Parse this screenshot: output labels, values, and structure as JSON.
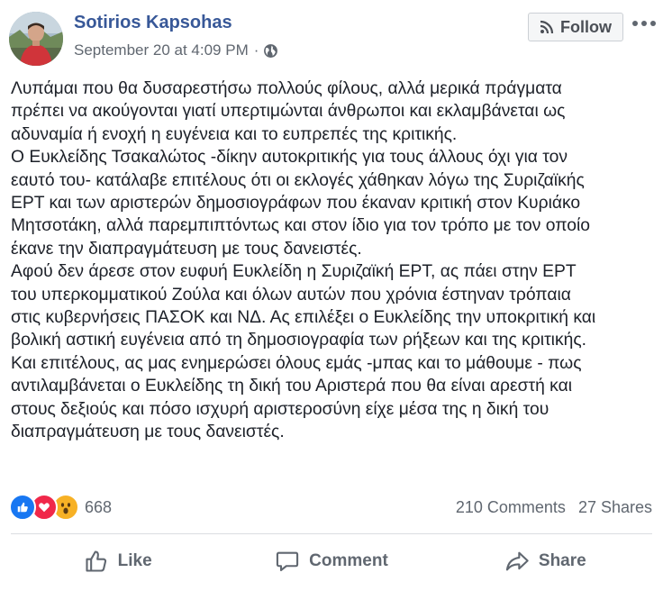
{
  "header": {
    "author": "Sotirios Kapsohas",
    "timestamp": "September 20 at 4:09 PM",
    "separator": "·",
    "privacy_icon": "globe-icon",
    "follow_label": "Follow",
    "follow_icon": "rss-icon",
    "more_icon": "more-options-icon"
  },
  "post": {
    "lines": [
      "Λυπάμαι που θα δυσαρεστήσω πολλούς φίλους, αλλά μερικά πράγματα",
      "πρέπει να ακούγονται γιατί υπερτιμώνται άνθρωποι και εκλαμβάνεται ως",
      "αδυναμία ή ενοχή η ευγένεια και το ευπρεπές της κριτικής.",
      "Ο Ευκλείδης Τσακαλώτος -δίκην αυτοκριτικής για τους άλλους όχι για τον",
      "εαυτό του- κατάλαβε επιτέλους ότι οι εκλογές χάθηκαν λόγω της Συριζαϊκής",
      "ΕΡΤ και των αριστερών δημοσιογράφων που έκαναν κριτική στον Κυριάκο",
      "Μητσοτάκη, αλλά παρεμπιπτόντως και στον ίδιο για τον τρόπο με τον οποίο",
      "έκανε την διαπραγμάτευση με τους δανειστές.",
      "Αφού δεν άρεσε στον ευφυή Ευκλείδη η Συριζαϊκή ΕΡΤ, ας πάει στην ΕΡΤ",
      "του υπερκομματικού Ζούλα και όλων αυτών που χρόνια έστηναν τρόπαια",
      "στις κυβερνήσεις ΠΑΣΟΚ και ΝΔ. Ας επιλέξει ο Ευκλείδης την υποκριτική και",
      "βολική αστική ευγένεια από τη δημοσιογραφία των ρήξεων και της κριτικής.",
      "Και επιτέλους, ας μας ενημερώσει όλους εμάς -μπας και το μάθουμε - πως",
      "αντιλαμβάνεται ο Ευκλείδης τη δική του Αριστερά που θα είναι αρεστή και",
      "στους δεξιούς και πόσο ισχυρή αριστεροσύνη είχε μέσα της η δική του",
      "διαπραγμάτευση με τους δανειστές."
    ]
  },
  "reactions": {
    "icons": [
      "like-reaction-icon",
      "love-reaction-icon",
      "wow-reaction-icon"
    ],
    "count": "668"
  },
  "stats": {
    "comments": "210 Comments",
    "shares": "27 Shares"
  },
  "actions": {
    "like": "Like",
    "comment": "Comment",
    "share": "Share"
  },
  "colors": {
    "author": "#385898",
    "text": "#1d2129",
    "muted": "#606770",
    "like": "#1877f2",
    "love": "#f0284a",
    "wow": "#f7b125"
  }
}
